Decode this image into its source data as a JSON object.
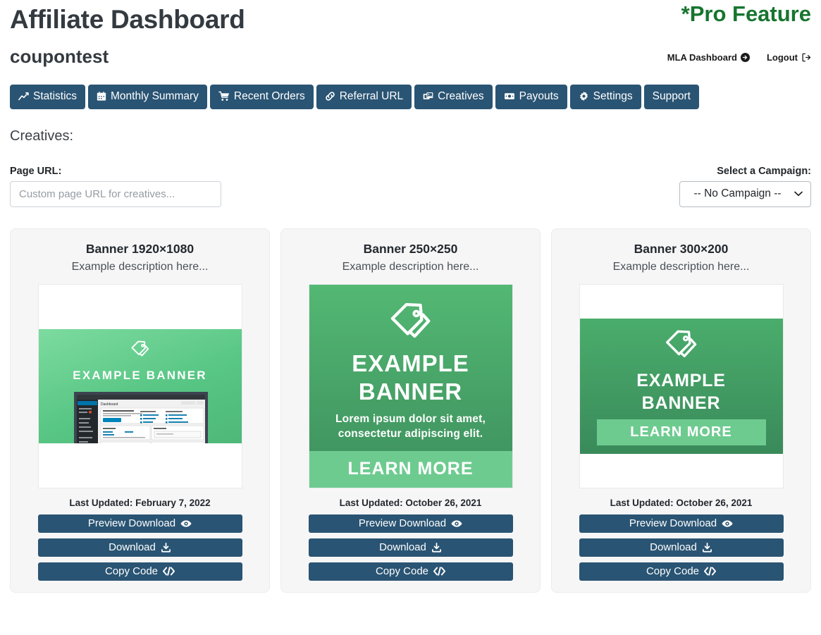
{
  "header": {
    "title": "Affiliate Dashboard",
    "pro_badge": "*Pro Feature",
    "account_name": "coupontest",
    "links": [
      {
        "label": "MLA Dashboard",
        "icon": "arrow-circle-right-icon"
      },
      {
        "label": "Logout",
        "icon": "sign-out-icon"
      }
    ]
  },
  "nav_tabs": [
    {
      "label": "Statistics",
      "icon": "line-chart-icon"
    },
    {
      "label": "Monthly Summary",
      "icon": "calendar-icon"
    },
    {
      "label": "Recent Orders",
      "icon": "shopping-cart-icon"
    },
    {
      "label": "Referral URL",
      "icon": "link-icon"
    },
    {
      "label": "Creatives",
      "icon": "images-icon"
    },
    {
      "label": "Payouts",
      "icon": "money-bill-icon"
    },
    {
      "label": "Settings",
      "icon": "gear-icon"
    },
    {
      "label": "Support",
      "icon": "none"
    }
  ],
  "section": {
    "title": "Creatives:"
  },
  "form": {
    "page_url_label": "Page URL:",
    "page_url_value": "",
    "page_url_placeholder": "Custom page URL for creatives...",
    "campaign_label": "Select a Campaign:",
    "campaign_selected": "-- No Campaign --"
  },
  "colors": {
    "button_blue": "#2a5473",
    "pro_green": "#17752f",
    "banner_green": "#4aad6c",
    "card_bg": "#f6f6f7"
  },
  "creatives": [
    {
      "title": "Banner 1920×1080",
      "description": "Example description here...",
      "last_updated": "Last Updated: February 7, 2022",
      "banner": {
        "style": "wide",
        "headline": "EXAMPLE BANNER",
        "subtext": "",
        "cta": ""
      },
      "buttons": [
        {
          "label": "Preview Download",
          "icon": "eye-icon"
        },
        {
          "label": "Download",
          "icon": "download-icon"
        },
        {
          "label": "Copy Code",
          "icon": "code-icon"
        }
      ]
    },
    {
      "title": "Banner 250×250",
      "description": "Example description here...",
      "last_updated": "Last Updated: October 26, 2021",
      "banner": {
        "style": "square",
        "headline_line1": "EXAMPLE",
        "headline_line2": "BANNER",
        "subtext_line1": "Lorem ipsum dolor sit amet,",
        "subtext_line2": "consectetur adipiscing elit.",
        "cta": "LEARN MORE"
      },
      "buttons": [
        {
          "label": "Preview Download",
          "icon": "eye-icon"
        },
        {
          "label": "Download",
          "icon": "download-icon"
        },
        {
          "label": "Copy Code",
          "icon": "code-icon"
        }
      ]
    },
    {
      "title": "Banner 300×200",
      "description": "Example description here...",
      "last_updated": "Last Updated: October 26, 2021",
      "banner": {
        "style": "medium",
        "headline_line1": "EXAMPLE",
        "headline_line2": "BANNER",
        "cta": "LEARN MORE"
      },
      "buttons": [
        {
          "label": "Preview Download",
          "icon": "eye-icon"
        },
        {
          "label": "Download",
          "icon": "download-icon"
        },
        {
          "label": "Copy Code",
          "icon": "code-icon"
        }
      ]
    }
  ]
}
